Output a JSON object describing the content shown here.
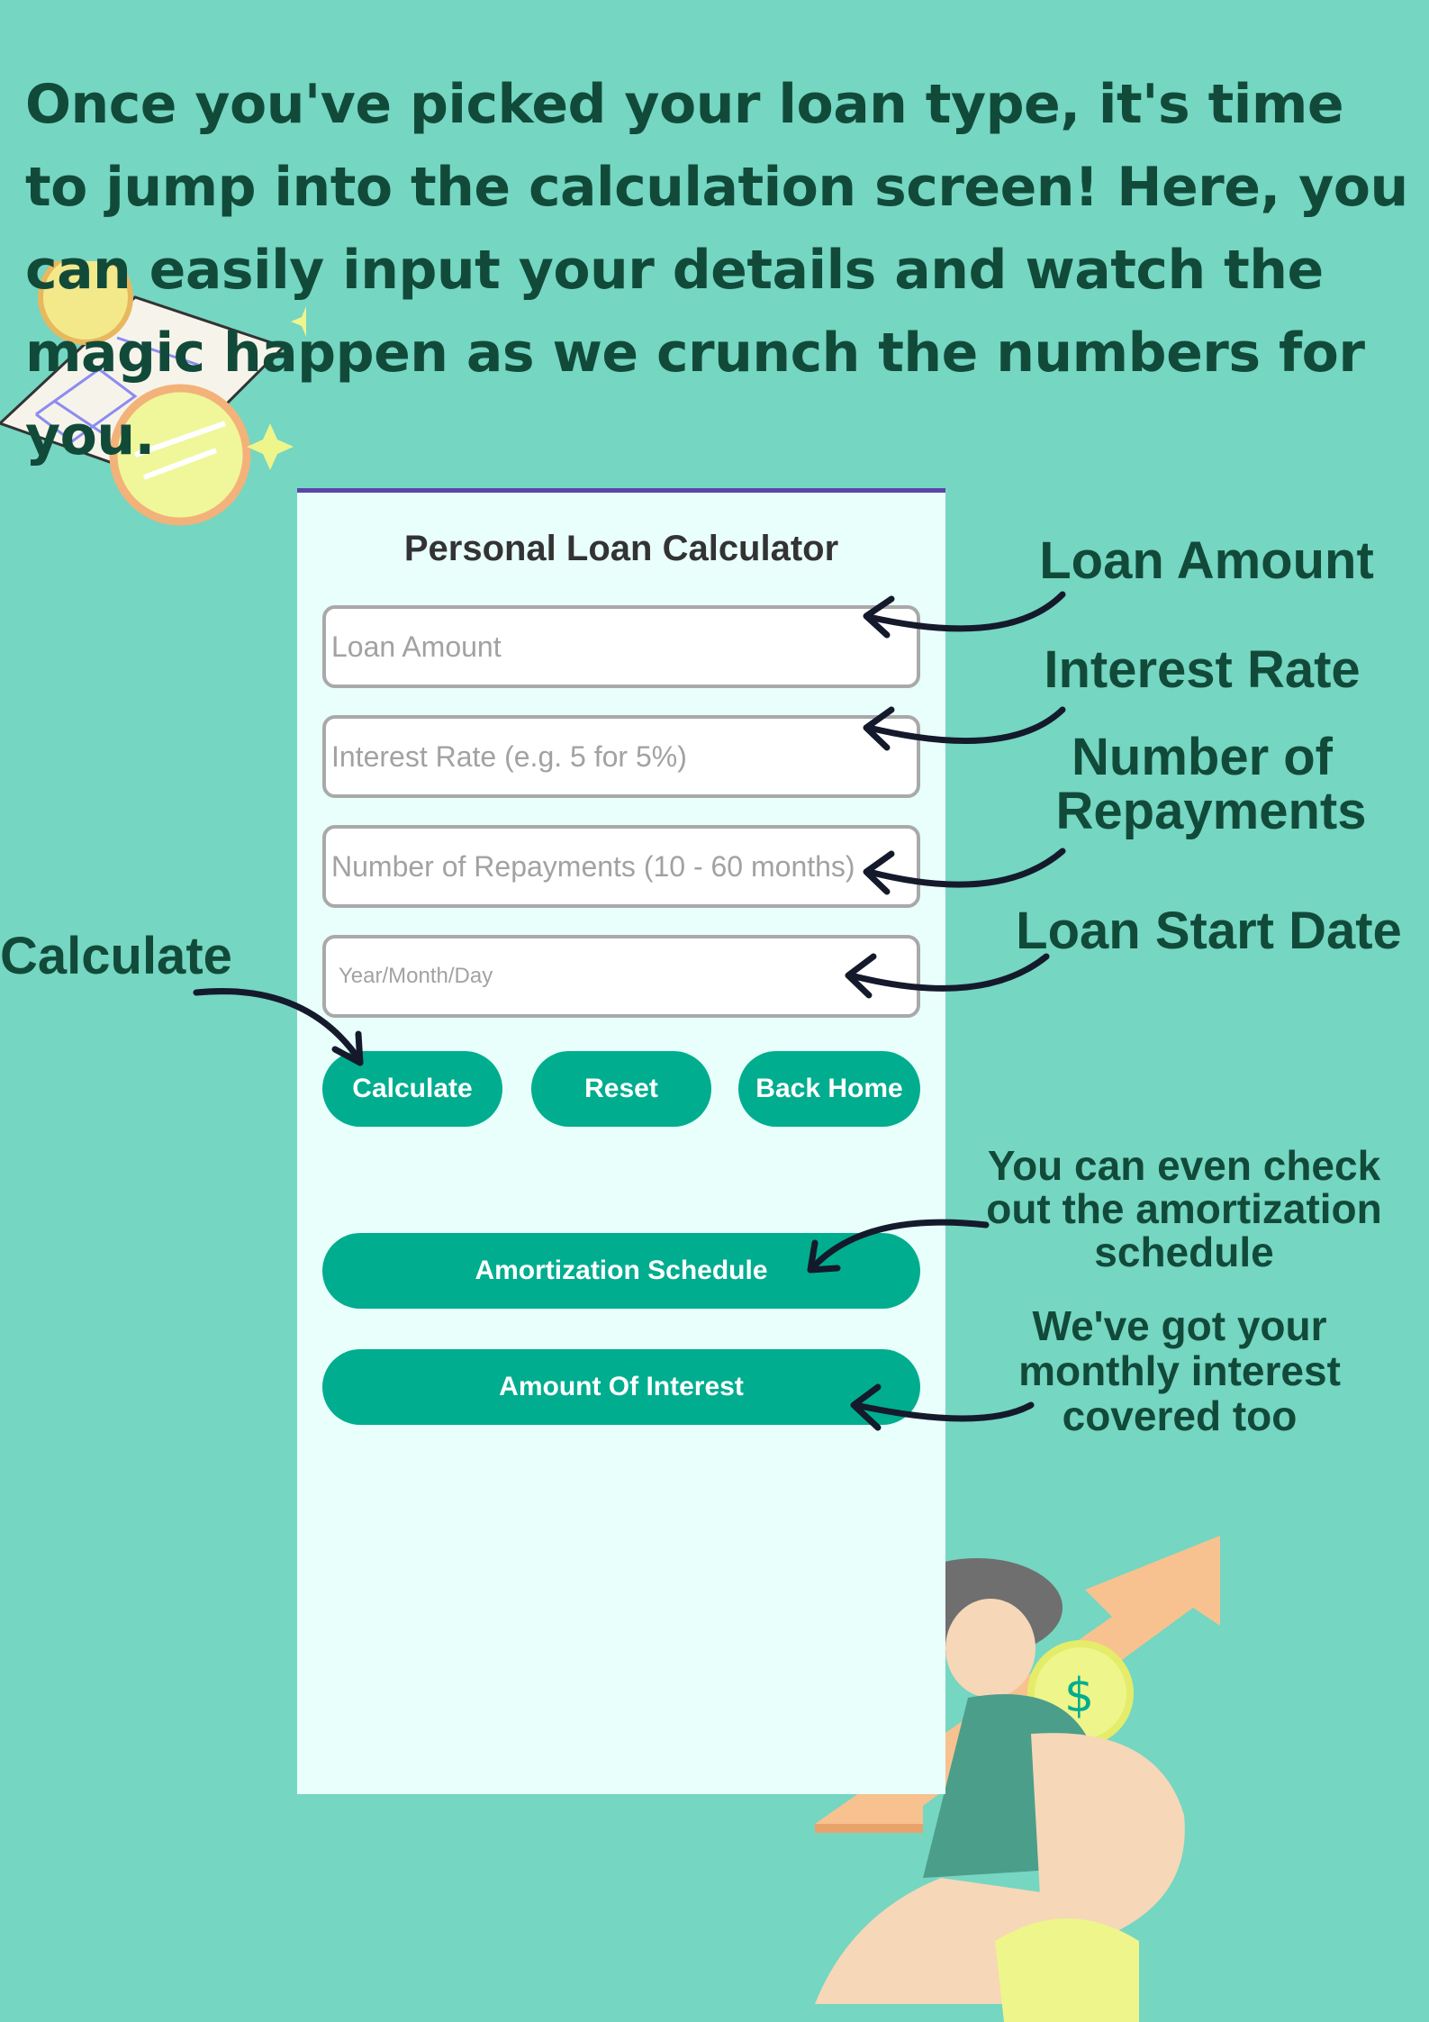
{
  "intro": "Once you've picked your loan type, it's time to jump into the calculation screen! Here, you can easily input your details and watch the magic happen as we crunch the numbers for you.",
  "app": {
    "title": "Personal Loan Calculator",
    "loan_amount_placeholder": "Loan Amount",
    "interest_rate_placeholder": "Interest Rate (e.g. 5 for 5%)",
    "repayments_placeholder": "Number of Repayments (10 - 60 months)",
    "start_date_placeholder": "Year/Month/Day",
    "calculate_label": "Calculate",
    "reset_label": "Reset",
    "back_home_label": "Back Home",
    "amortization_label": "Amortization Schedule",
    "interest_label": "Amount Of Interest"
  },
  "annotations": {
    "loan_amount": "Loan Amount",
    "interest_rate": "Interest Rate",
    "repayments_line1": "Number of",
    "repayments_line2": "Repayments",
    "start_date": "Loan Start Date",
    "calculate": "Calculate",
    "amortization_line1": "You can even check",
    "amortization_line2": "out the amortization",
    "amortization_line3": "schedule",
    "interest_line1": "We've got your",
    "interest_line2": "monthly interest",
    "interest_line3": "covered too"
  },
  "icons": [
    "bill-with-coins-illustration",
    "person-with-coin-and-arrow-illustration",
    "annotation-arrow"
  ],
  "colors": {
    "background": "#75d6c2",
    "heading_text": "#124a3a",
    "accent_button": "#00ad8f",
    "screen_background": "#e9fffb",
    "status_bar": "#5b46a8"
  }
}
